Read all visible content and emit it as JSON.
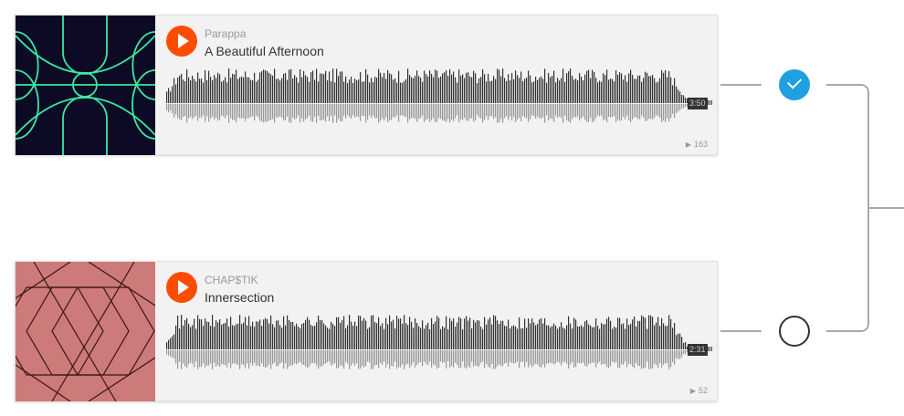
{
  "tracks": [
    {
      "artist": "Parappa",
      "title": "A Beautiful Afternoon",
      "duration": "3:50",
      "plays": "163",
      "selected": true,
      "art_color": "#0d0a26",
      "art_line_color": "#3be89f"
    },
    {
      "artist": "CHAP$TIK",
      "title": "Innersection",
      "duration": "2:31",
      "plays": "52",
      "selected": false,
      "art_color": "#cd7a7a",
      "art_line_color": "#3a1518"
    }
  ],
  "colors": {
    "accent": "#ff4c00",
    "check_blue": "#1fa0e0",
    "connector": "#aaaaaa"
  },
  "icons": {
    "play": "play-icon",
    "check": "check-icon"
  }
}
